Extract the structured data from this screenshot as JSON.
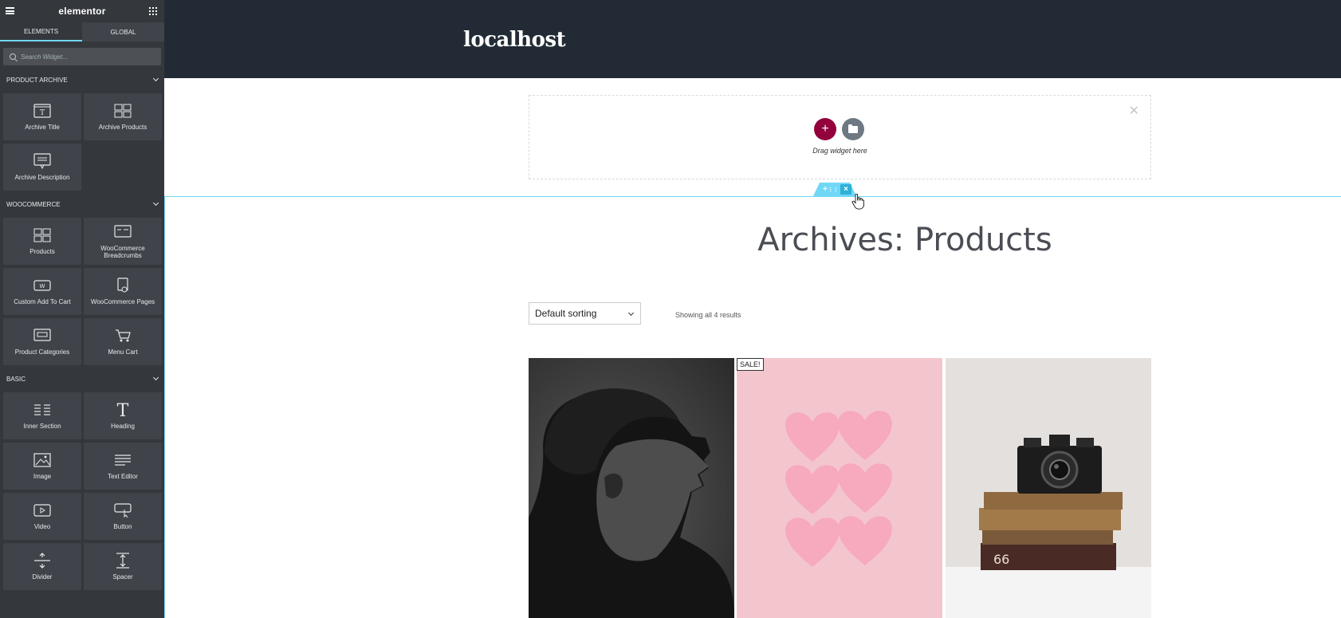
{
  "editor": {
    "logo": "elementor",
    "tabs": [
      {
        "label": "ELEMENTS",
        "active": true
      },
      {
        "label": "GLOBAL",
        "active": false
      }
    ],
    "search": {
      "placeholder": "Search Widget..."
    },
    "categories": [
      {
        "title": "PRODUCT ARCHIVE",
        "widgets": [
          {
            "label": "Archive Title",
            "icon": "archive-title-icon"
          },
          {
            "label": "Archive Products",
            "icon": "archive-products-icon"
          },
          {
            "label": "Archive Description",
            "icon": "archive-description-icon"
          }
        ]
      },
      {
        "title": "WOOCOMMERCE",
        "widgets": [
          {
            "label": "Products",
            "icon": "products-icon"
          },
          {
            "label": "WooCommerce Breadcrumbs",
            "icon": "breadcrumbs-icon"
          },
          {
            "label": "Custom Add To Cart",
            "icon": "add-to-cart-icon"
          },
          {
            "label": "WooCommerce Pages",
            "icon": "woo-pages-icon"
          },
          {
            "label": "Product Categories",
            "icon": "product-categories-icon"
          },
          {
            "label": "Menu Cart",
            "icon": "cart-icon"
          }
        ]
      },
      {
        "title": "BASIC",
        "widgets": [
          {
            "label": "Inner Section",
            "icon": "inner-section-icon"
          },
          {
            "label": "Heading",
            "icon": "heading-icon"
          },
          {
            "label": "Image",
            "icon": "image-icon"
          },
          {
            "label": "Text Editor",
            "icon": "text-editor-icon"
          },
          {
            "label": "Video",
            "icon": "video-icon"
          },
          {
            "label": "Button",
            "icon": "button-icon"
          },
          {
            "label": "Divider",
            "icon": "divider-icon"
          },
          {
            "label": "Spacer",
            "icon": "spacer-icon"
          }
        ]
      }
    ]
  },
  "site": {
    "title": "localhost",
    "header_color": "#222b35"
  },
  "empty_section": {
    "drag_text": "Drag widget here",
    "add_color": "#93003c"
  },
  "archive": {
    "title": "Archives: Products",
    "sort_selected": "Default sorting",
    "result_count": "Showing all 4 results",
    "sale_badge": "SALE!"
  },
  "colors": {
    "accent": "#71d7f7",
    "sidebar_bg": "#34383c",
    "widget_bg": "#404349"
  }
}
